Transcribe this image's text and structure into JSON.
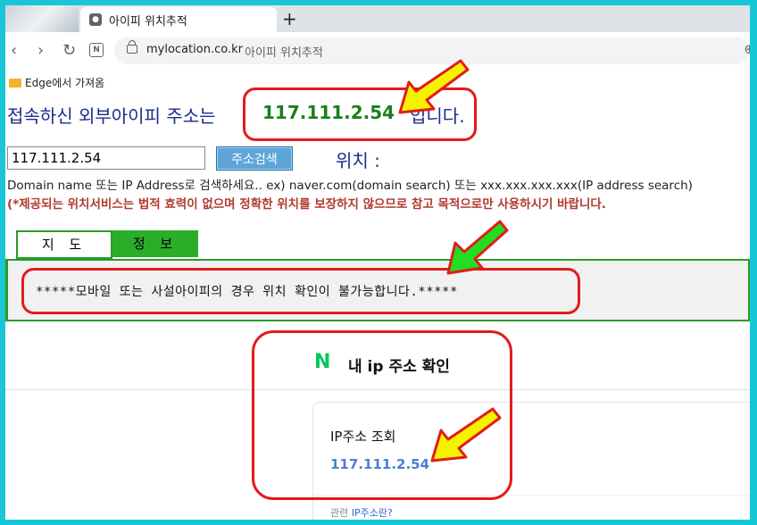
{
  "browser": {
    "tab_title": "아이피 위치추적",
    "new_tab": "+",
    "url": "mylocation.co.kr",
    "page_title": "아이피 위치추적",
    "favorites_folder": "Edge에서 가져옴"
  },
  "page": {
    "headline_prefix": "접속하신 외부아이피 주소는",
    "public_ip": "117.111.2.54",
    "headline_suffix": "입니다.",
    "search_value": "117.111.2.54",
    "search_button": "주소검색",
    "location_label": "위치 :",
    "help_text": "Domain name 또는 IP Address로 검색하세요.. ex) naver.com(domain search) 또는 xxx.xxx.xxx.xxx(IP address search)",
    "warning_text": "(*제공되는 위치서비스는 법적 효력이 없으며 정확한 위치를 보장하지 않으므로 참고 목적으로만 사용하시기 바랍니다.",
    "tab_map": "지 도",
    "tab_info": "정 보",
    "notice": "*****모바일 또는 사설아이피의 경우 위치 확인이 불가능합니다.*****"
  },
  "naver": {
    "logo": "N",
    "title": "내 ip 주소 확인",
    "card_title": "IP주소 조회",
    "card_ip": "117.111.2.54",
    "footer_prefix": "관련",
    "footer_link": "IP주소란?"
  },
  "colors": {
    "highlight": "#e31b1b",
    "arrow_yellow": "#f5f200",
    "arrow_green": "#22dd22",
    "frame": "#19c6d6"
  }
}
